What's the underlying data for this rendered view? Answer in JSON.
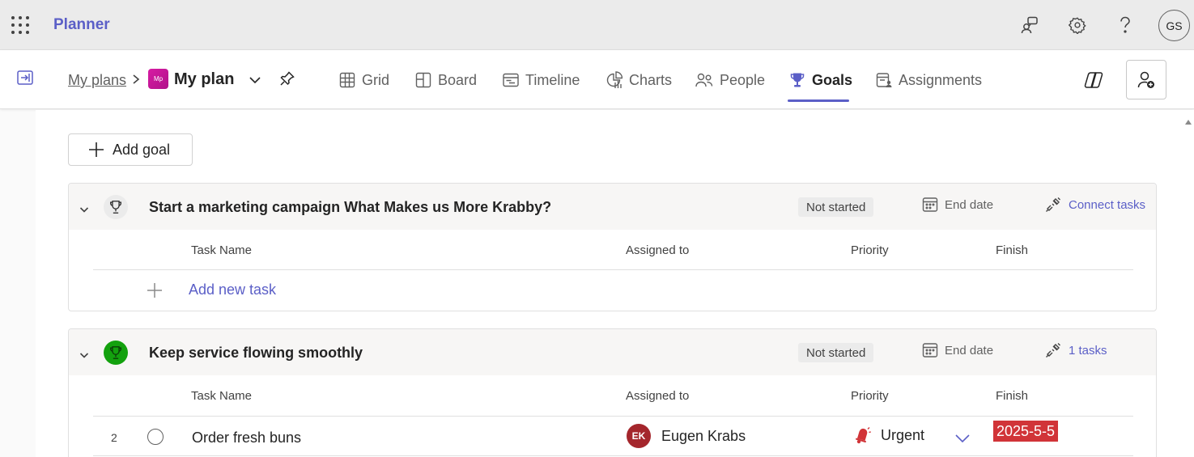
{
  "app": {
    "name": "Planner"
  },
  "topbar": {
    "avatar_initials": "GS",
    "icons": [
      "people-community-icon",
      "settings-icon",
      "help-icon"
    ]
  },
  "plan": {
    "breadcrumb_link": "My plans",
    "badge": "Mp",
    "title": "My plan"
  },
  "tabs": [
    {
      "label": "Grid",
      "icon": "grid-icon"
    },
    {
      "label": "Board",
      "icon": "board-icon"
    },
    {
      "label": "Timeline",
      "icon": "timeline-icon"
    },
    {
      "label": "Charts",
      "icon": "charts-icon"
    },
    {
      "label": "People",
      "icon": "people-icon"
    },
    {
      "label": "Goals",
      "icon": "trophy-icon",
      "active": true
    },
    {
      "label": "Assignments",
      "icon": "assignments-icon"
    }
  ],
  "toolbar": {
    "add_goal_label": "Add goal"
  },
  "columns": {
    "task_name": "Task Name",
    "assigned_to": "Assigned to",
    "priority": "Priority",
    "finish": "Finish"
  },
  "goals": [
    {
      "title": "Start a marketing campaign What Makes us More Krabby?",
      "status": "Not started",
      "end_date": "End date",
      "tasks_link": "Connect tasks",
      "add_task_label": "Add new task"
    },
    {
      "title": "Keep service flowing smoothly",
      "status": "Not started",
      "end_date": "End date",
      "tasks_link": "1 tasks",
      "tasks": [
        {
          "number": "2",
          "name": "Order fresh buns",
          "assignee_initials": "EK",
          "assignee_name": "Eugen Krabs",
          "priority": "Urgent",
          "finish": "2025-5-5"
        }
      ]
    }
  ],
  "colors": {
    "accent": "#5b5fc7",
    "urgent": "#d13438",
    "goal_green": "#13a10e",
    "plan_badge": "#c5178f"
  }
}
